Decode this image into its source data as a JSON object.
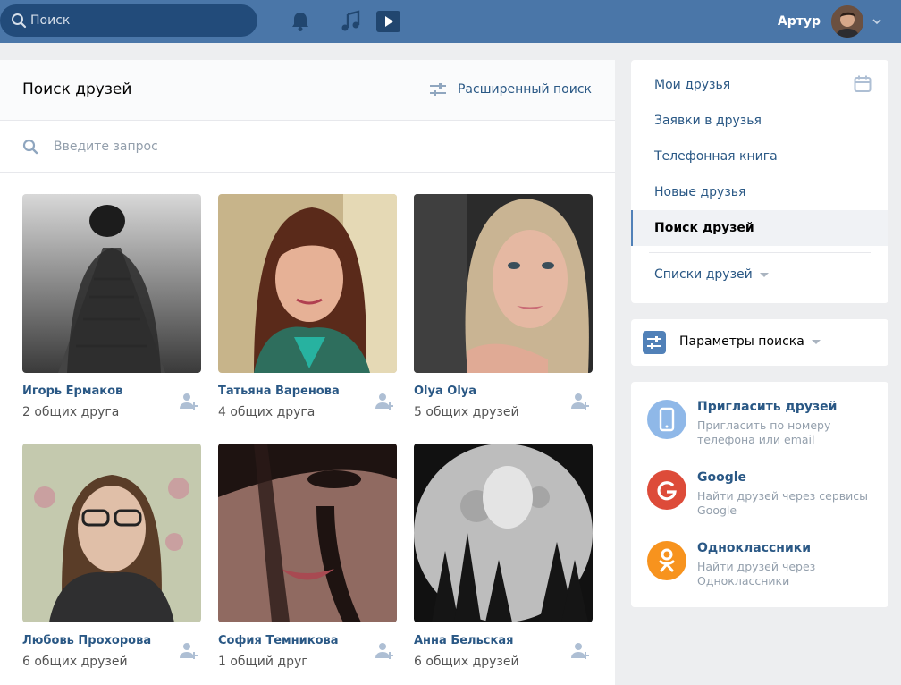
{
  "header": {
    "search_placeholder": "Поиск",
    "user_name": "Артур",
    "icons": [
      "bell-icon",
      "music-icon",
      "video-icon"
    ]
  },
  "main": {
    "title": "Поиск друзей",
    "advanced_search": "Расширенный поиск",
    "query_placeholder": "Введите запрос",
    "people": [
      {
        "name": "Игорь Ермаков",
        "mutual": "2 общих друга"
      },
      {
        "name": "Татьяна Варенова",
        "mutual": "4 общих друга"
      },
      {
        "name": "Olya Olya",
        "mutual": "5 общих друзей"
      },
      {
        "name": "Любовь Прохорова",
        "mutual": "6 общих друзей"
      },
      {
        "name": "София Темникова",
        "mutual": "1 общий друг"
      },
      {
        "name": "Анна Бельская",
        "mutual": "6 общих друзей"
      }
    ]
  },
  "sidebar": {
    "items": [
      {
        "label": "Мои друзья"
      },
      {
        "label": "Заявки в друзья"
      },
      {
        "label": "Телефонная книга"
      },
      {
        "label": "Новые друзья"
      },
      {
        "label": "Поиск друзей"
      }
    ],
    "lists_label": "Списки друзей",
    "params_label": "Параметры поиска"
  },
  "invite": [
    {
      "title": "Пригласить друзей",
      "desc": "Пригласить по номеру телефона или email"
    },
    {
      "title": "Google",
      "desc": "Найти друзей через сервисы Google"
    },
    {
      "title": "Одноклассники",
      "desc": "Найти друзей через Одноклассники"
    }
  ],
  "colors": {
    "header": "#4a76a8",
    "link": "#2a5885",
    "phone": "#8fb8e8",
    "google": "#dd4b39",
    "ok": "#f7931e"
  }
}
